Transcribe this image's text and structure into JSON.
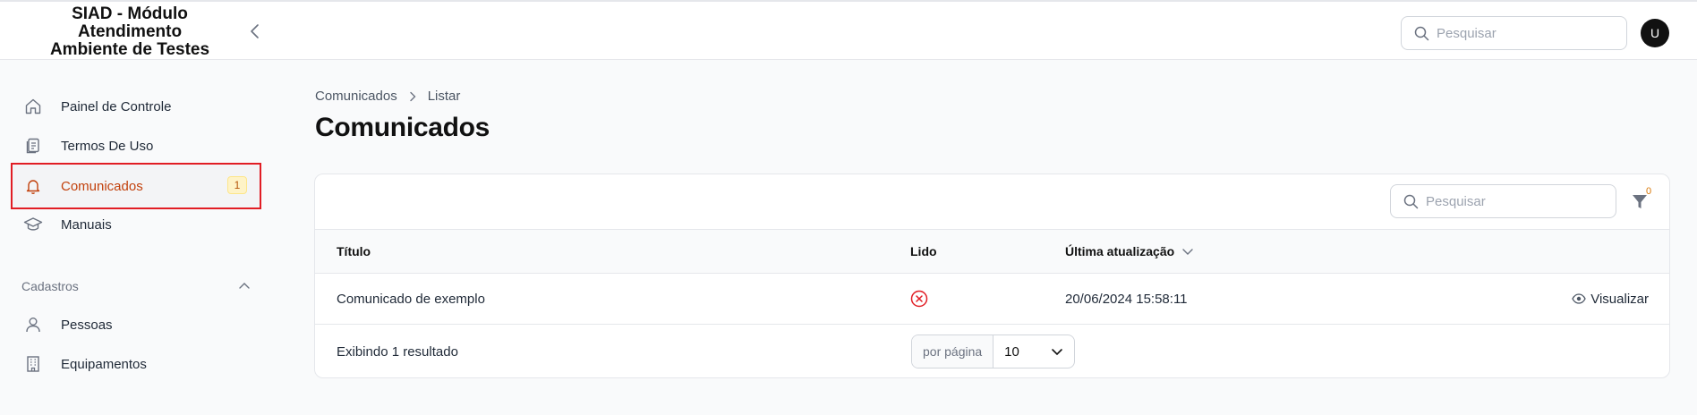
{
  "app": {
    "title_line1": "SIAD - Módulo",
    "title_line2": "Atendimento",
    "title_line3": "Ambiente de Testes"
  },
  "header": {
    "search_placeholder": "Pesquisar",
    "avatar_initial": "U"
  },
  "sidebar": {
    "items": [
      {
        "label": "Painel de Controle",
        "icon": "home-icon"
      },
      {
        "label": "Termos De Uso",
        "icon": "document-icon"
      },
      {
        "label": "Comunicados",
        "icon": "bell-icon",
        "badge": "1",
        "active": true
      },
      {
        "label": "Manuais",
        "icon": "graduation-cap-icon"
      }
    ],
    "section_title": "Cadastros",
    "section_items": [
      {
        "label": "Pessoas",
        "icon": "user-icon"
      },
      {
        "label": "Equipamentos",
        "icon": "building-icon"
      }
    ]
  },
  "breadcrumb": {
    "parent": "Comunicados",
    "current": "Listar"
  },
  "page": {
    "title": "Comunicados"
  },
  "table": {
    "search_placeholder": "Pesquisar",
    "filter_count": "0",
    "columns": {
      "titulo": "Título",
      "lido": "Lido",
      "atualizacao": "Última atualização"
    },
    "rows": [
      {
        "titulo": "Comunicado de exemplo",
        "lido": "unread",
        "atualizacao": "20/06/2024 15:58:11",
        "action": "Visualizar"
      }
    ],
    "footer": {
      "result_text": "Exibindo 1 resultado",
      "per_page_label": "por página",
      "per_page_value": "10"
    }
  },
  "colors": {
    "accent": "#c2410c",
    "highlight_border": "#e11d24",
    "unread_icon": "#e11d24",
    "badge_bg": "#fef3c7"
  }
}
